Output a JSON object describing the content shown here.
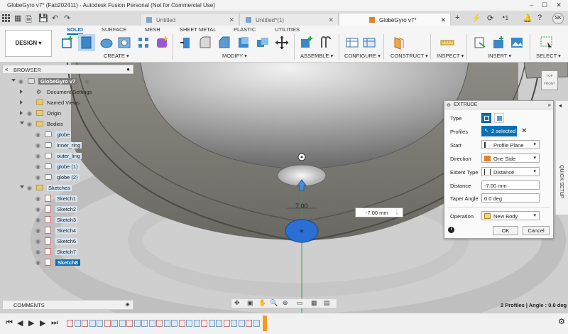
{
  "window": {
    "title": "GlobeGyro v7* (Fab202411) - Autodesk Fusion Personal (Not for Commercial Use)",
    "minimize": "–",
    "maximize": "☐",
    "close": "✕"
  },
  "tabs": [
    {
      "label": "Untitled"
    },
    {
      "label": "Untitled*(1)"
    },
    {
      "label": "GlobeGyro v7*"
    }
  ],
  "tab_close": "✕",
  "new_tab": "+",
  "job_count": "1",
  "user_initials": "SK",
  "ribbon": {
    "workspace": "DESIGN",
    "workspace_tabs": [
      "SOLID",
      "SURFACE",
      "MESH",
      "SHEET METAL",
      "PLASTIC",
      "UTILITIES"
    ],
    "groups": [
      "CREATE",
      "MODIFY",
      "ASSEMBLE",
      "CONFIGURE",
      "CONSTRUCT",
      "INSPECT",
      "INSERT",
      "SELECT"
    ]
  },
  "browser": {
    "title": "BROWSER",
    "root": "GlobeGyro v7",
    "items": [
      {
        "label": "Document Settings"
      },
      {
        "label": "Named Views"
      },
      {
        "label": "Origin"
      },
      {
        "label": "Bodies"
      },
      {
        "label": "globe"
      },
      {
        "label": "inner_ring"
      },
      {
        "label": "outer_ling"
      },
      {
        "label": "globe (1)"
      },
      {
        "label": "globe (2)"
      },
      {
        "label": "Sketches"
      },
      {
        "label": "Sketch1"
      },
      {
        "label": "Sketch2"
      },
      {
        "label": "Sketch3"
      },
      {
        "label": "Sketch4"
      },
      {
        "label": "Sketch6"
      },
      {
        "label": "Sketch7"
      },
      {
        "label": "Sketch8"
      }
    ]
  },
  "comments": "COMMENTS",
  "canvas": {
    "dimension": "7.00",
    "value_input": "-7.00 mm",
    "viewcube_top": "TOP",
    "viewcube_front": "FRONT"
  },
  "extrude": {
    "title": "EXTRUDE",
    "type_label": "Type",
    "profiles_label": "Profiles",
    "profiles_value": "2 selected",
    "start_label": "Start",
    "start_value": "Profile Plane",
    "direction_label": "Direction",
    "direction_value": "One Side",
    "extent_label": "Extent Type",
    "extent_value": "Distance",
    "distance_label": "Distance",
    "distance_value": "-7.00 mm",
    "taper_label": "Taper Angle",
    "taper_value": "0.0 deg",
    "operation_label": "Operation",
    "operation_value": "New Body",
    "ok": "OK",
    "cancel": "Cancel"
  },
  "quick_setup": "QUICK SETUP",
  "status": "2 Profiles | Angle : 0.0 deg",
  "colors": {
    "accent": "#0a6fb8",
    "selection_fill": "#2a6fd3",
    "timeline_marker": "#f29c1f"
  }
}
